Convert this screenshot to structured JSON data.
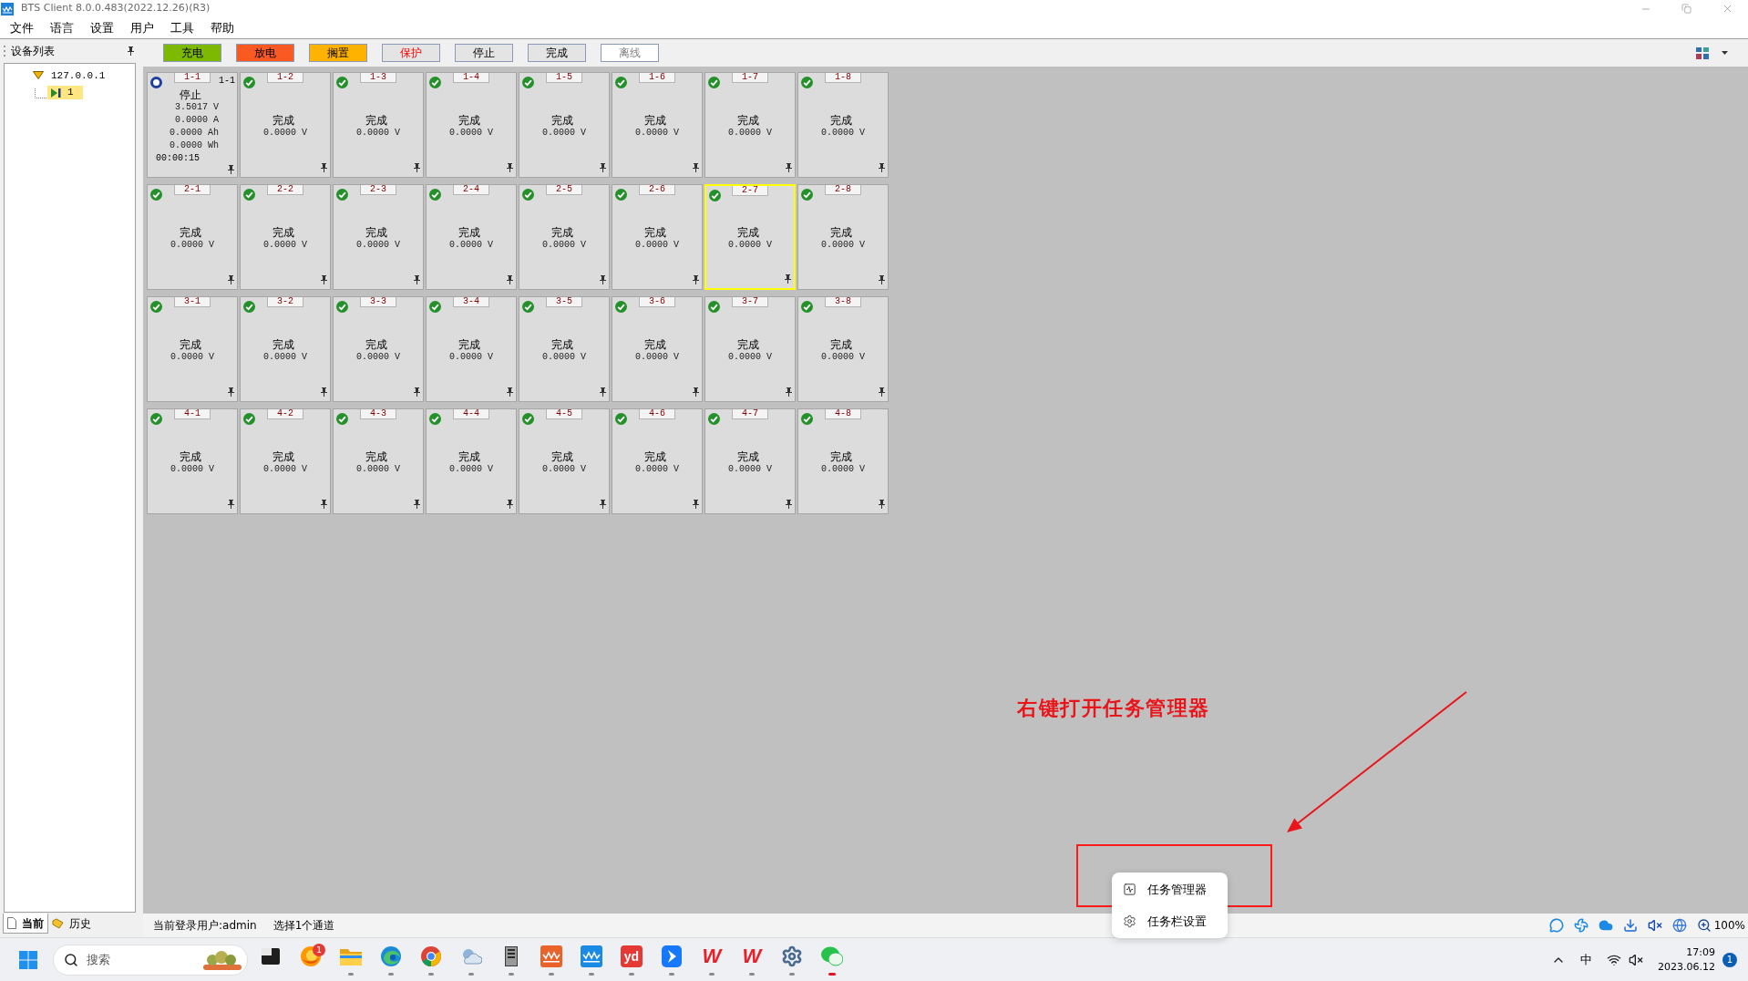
{
  "window": {
    "title": "BTS Client 8.0.0.483(2022.12.26)(R3)"
  },
  "menu": [
    "文件",
    "语言",
    "设置",
    "用户",
    "工具",
    "帮助"
  ],
  "sidebar": {
    "title": "设备列表",
    "tree": [
      {
        "label": "127.0.0.1",
        "expanded": true,
        "selected": false,
        "children": [
          {
            "label": "1",
            "selected": true
          }
        ]
      }
    ],
    "tabs": [
      {
        "label": "当前",
        "selected": true
      },
      {
        "label": "历史",
        "selected": false
      }
    ]
  },
  "legend": [
    {
      "label": "充电",
      "color": "#7cb900",
      "kind": "normal"
    },
    {
      "label": "放电",
      "color": "#fa5a22",
      "kind": "normal"
    },
    {
      "label": "搁置",
      "color": "#ffb200",
      "kind": "normal"
    },
    {
      "label": "保护",
      "color": "#e4e4e4",
      "kind": "alert"
    },
    {
      "label": "停止",
      "color": "#e4e4e4",
      "kind": "normal"
    },
    {
      "label": "完成",
      "color": "#e4e4e4",
      "kind": "normal"
    },
    {
      "label": "离线",
      "color": "#ffffff",
      "kind": "muted"
    }
  ],
  "channel_rows": [
    [
      {
        "label": "1-1",
        "corner_label": "1-1",
        "kind": "stopped",
        "status": "停止",
        "readings": [
          "3.5017 V",
          "0.0000 A",
          "0.0000 Ah",
          "0.0000 Wh"
        ],
        "time": "00:00:15",
        "selected": false
      },
      {
        "label": "1-2",
        "kind": "done",
        "status": "完成",
        "readings": [
          "0.0000 V"
        ],
        "selected": false
      },
      {
        "label": "1-3",
        "kind": "done",
        "status": "完成",
        "readings": [
          "0.0000 V"
        ],
        "selected": false
      },
      {
        "label": "1-4",
        "kind": "done",
        "status": "完成",
        "readings": [
          "0.0000 V"
        ],
        "selected": false
      },
      {
        "label": "1-5",
        "kind": "done",
        "status": "完成",
        "readings": [
          "0.0000 V"
        ],
        "selected": false
      },
      {
        "label": "1-6",
        "kind": "done",
        "status": "完成",
        "readings": [
          "0.0000 V"
        ],
        "selected": false
      },
      {
        "label": "1-7",
        "kind": "done",
        "status": "完成",
        "readings": [
          "0.0000 V"
        ],
        "selected": false
      },
      {
        "label": "1-8",
        "kind": "done",
        "status": "完成",
        "readings": [
          "0.0000 V"
        ],
        "selected": false
      }
    ],
    [
      {
        "label": "2-1",
        "kind": "done",
        "status": "完成",
        "readings": [
          "0.0000 V"
        ],
        "selected": false
      },
      {
        "label": "2-2",
        "kind": "done",
        "status": "完成",
        "readings": [
          "0.0000 V"
        ],
        "selected": false
      },
      {
        "label": "2-3",
        "kind": "done",
        "status": "完成",
        "readings": [
          "0.0000 V"
        ],
        "selected": false
      },
      {
        "label": "2-4",
        "kind": "done",
        "status": "完成",
        "readings": [
          "0.0000 V"
        ],
        "selected": false
      },
      {
        "label": "2-5",
        "kind": "done",
        "status": "完成",
        "readings": [
          "0.0000 V"
        ],
        "selected": false
      },
      {
        "label": "2-6",
        "kind": "done",
        "status": "完成",
        "readings": [
          "0.0000 V"
        ],
        "selected": false
      },
      {
        "label": "2-7",
        "kind": "done",
        "status": "完成",
        "readings": [
          "0.0000 V"
        ],
        "selected": true
      },
      {
        "label": "2-8",
        "kind": "done",
        "status": "完成",
        "readings": [
          "0.0000 V"
        ],
        "selected": false
      }
    ],
    [
      {
        "label": "3-1",
        "kind": "done",
        "status": "完成",
        "readings": [
          "0.0000 V"
        ],
        "selected": false
      },
      {
        "label": "3-2",
        "kind": "done",
        "status": "完成",
        "readings": [
          "0.0000 V"
        ],
        "selected": false
      },
      {
        "label": "3-3",
        "kind": "done",
        "status": "完成",
        "readings": [
          "0.0000 V"
        ],
        "selected": false
      },
      {
        "label": "3-4",
        "kind": "done",
        "status": "完成",
        "readings": [
          "0.0000 V"
        ],
        "selected": false
      },
      {
        "label": "3-5",
        "kind": "done",
        "status": "完成",
        "readings": [
          "0.0000 V"
        ],
        "selected": false
      },
      {
        "label": "3-6",
        "kind": "done",
        "status": "完成",
        "readings": [
          "0.0000 V"
        ],
        "selected": false
      },
      {
        "label": "3-7",
        "kind": "done",
        "status": "完成",
        "readings": [
          "0.0000 V"
        ],
        "selected": false
      },
      {
        "label": "3-8",
        "kind": "done",
        "status": "完成",
        "readings": [
          "0.0000 V"
        ],
        "selected": false
      }
    ],
    [
      {
        "label": "4-1",
        "kind": "done",
        "status": "完成",
        "readings": [
          "0.0000 V"
        ],
        "selected": false
      },
      {
        "label": "4-2",
        "kind": "done",
        "status": "完成",
        "readings": [
          "0.0000 V"
        ],
        "selected": false
      },
      {
        "label": "4-3",
        "kind": "done",
        "status": "完成",
        "readings": [
          "0.0000 V"
        ],
        "selected": false
      },
      {
        "label": "4-4",
        "kind": "done",
        "status": "完成",
        "readings": [
          "0.0000 V"
        ],
        "selected": false
      },
      {
        "label": "4-5",
        "kind": "done",
        "status": "完成",
        "readings": [
          "0.0000 V"
        ],
        "selected": false
      },
      {
        "label": "4-6",
        "kind": "done",
        "status": "完成",
        "readings": [
          "0.0000 V"
        ],
        "selected": false
      },
      {
        "label": "4-7",
        "kind": "done",
        "status": "完成",
        "readings": [
          "0.0000 V"
        ],
        "selected": false
      },
      {
        "label": "4-8",
        "kind": "done",
        "status": "完成",
        "readings": [
          "0.0000 V"
        ],
        "selected": false
      }
    ]
  ],
  "status_bar": {
    "user": "当前登录用户:admin",
    "selection": "选择1个通道",
    "zoom": "100%"
  },
  "context_menu": {
    "items": [
      {
        "label": "任务管理器",
        "kind": "task_manager"
      },
      {
        "label": "任务栏设置",
        "kind": "settings"
      }
    ]
  },
  "annotation": {
    "text": "右键打开任务管理器"
  },
  "taskbar": {
    "search": {
      "placeholder": "搜索"
    },
    "apps": [
      {
        "kind": "icon",
        "running": false,
        "active": false
      },
      {
        "kind": "icon",
        "badge": "1",
        "running": false,
        "active": false
      },
      {
        "kind": "icon",
        "running": true,
        "active": false
      },
      {
        "kind": "icon",
        "running": true,
        "active": false
      },
      {
        "kind": "icon",
        "running": true,
        "active": false
      },
      {
        "kind": "icon",
        "running": true,
        "active": false
      },
      {
        "kind": "icon",
        "running": true,
        "active": false
      },
      {
        "kind": "icon",
        "running": true,
        "active": false
      },
      {
        "kind": "icon",
        "running": true,
        "active": false
      },
      {
        "kind": "filled_logo",
        "logo_text": "yd",
        "running": true,
        "active": false
      },
      {
        "kind": "icon",
        "running": true,
        "active": false
      },
      {
        "kind": "plain_logo",
        "logo_text": "W",
        "running": true,
        "active": false
      },
      {
        "kind": "plain_logo",
        "logo_text": "W",
        "running": true,
        "active": false
      },
      {
        "kind": "icon",
        "running": true,
        "active": false
      },
      {
        "kind": "icon",
        "running": true,
        "active": true
      }
    ],
    "tray": {
      "input_method": "中",
      "time": "17:09",
      "date": "2023.06.12",
      "notification_count": "1"
    }
  }
}
